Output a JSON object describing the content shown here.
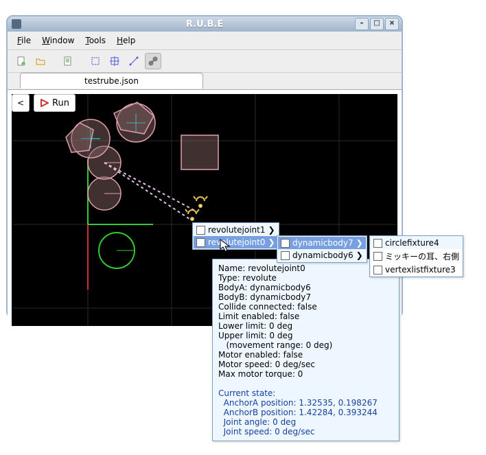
{
  "window": {
    "title": "R.U.B.E"
  },
  "menus": {
    "file": "File",
    "window": "Window",
    "tools": "Tools",
    "help": "Help"
  },
  "tab": {
    "label": "testrube.json"
  },
  "nav": {
    "back": "<",
    "run": "Run"
  },
  "pop1": {
    "item0": "revolutejoint1",
    "item1": "revolutejoint0"
  },
  "pop2": {
    "item0": "dynamicbody7",
    "item1": "dynamicbody6"
  },
  "pop3": {
    "item0": "circlefixture4",
    "item1": "ミッキーの耳、右側",
    "item2": "vertexlistfixture3"
  },
  "tip": {
    "l1": "Name: revolutejoint0",
    "l2": "Type: revolute",
    "l3": "BodyA: dynamicbody6",
    "l4": "BodyB: dynamicbody7",
    "l5": "Collide connected: false",
    "l6": "Limit enabled: false",
    "l7": "Lower limit: 0 deg",
    "l8": "Upper limit: 0 deg",
    "l9": "   (movement range: 0 deg)",
    "l10": "Motor enabled: false",
    "l11": "Motor speed: 0 deg/sec",
    "l12": "Max motor torque: 0",
    "l13": " ",
    "s0": "Current state:",
    "s1": "  AnchorA position: 1.32535, 0.198267",
    "s2": "  AnchorB position: 1.42284, 0.393244",
    "s3": "  Joint angle: 0 deg",
    "s4": "  Joint speed: 0 deg/sec"
  }
}
